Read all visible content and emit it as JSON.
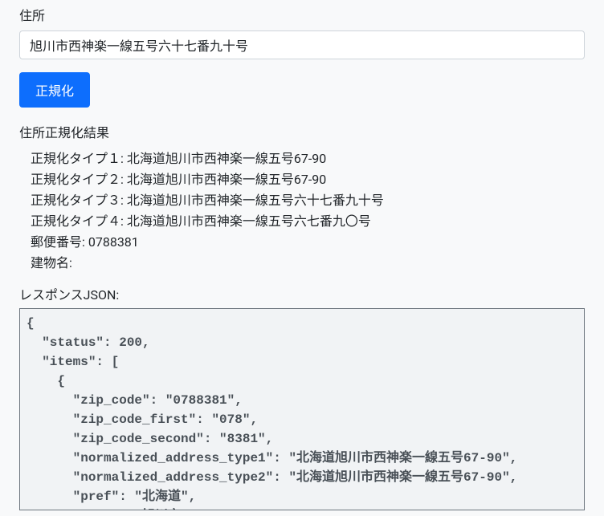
{
  "form": {
    "address_label": "住所",
    "address_value": "旭川市西神楽一線五号六十七番九十号",
    "submit_label": "正規化"
  },
  "results": {
    "heading": "住所正規化結果",
    "lines": [
      "正規化タイプ１: 北海道旭川市西神楽一線五号67-90",
      "正規化タイプ２: 北海道旭川市西神楽一線五号67-90",
      "正規化タイプ３: 北海道旭川市西神楽一線五号六十七番九十号",
      "正規化タイプ４: 北海道旭川市西神楽一線五号六七番九〇号",
      "郵便番号: 0788381",
      "建物名:"
    ]
  },
  "response": {
    "heading": "レスポンスJSON:",
    "json_text": "{\n  \"status\": 200,\n  \"items\": [\n    {\n      \"zip_code\": \"0788381\",\n      \"zip_code_first\": \"078\",\n      \"zip_code_second\": \"8381\",\n      \"normalized_address_type1\": \"北海道旭川市西神楽一線五号67-90\",\n      \"normalized_address_type2\": \"北海道旭川市西神楽一線五号67-90\",\n      \"pref\": \"北海道\",\n      \"city\": \"旭川市\","
  }
}
